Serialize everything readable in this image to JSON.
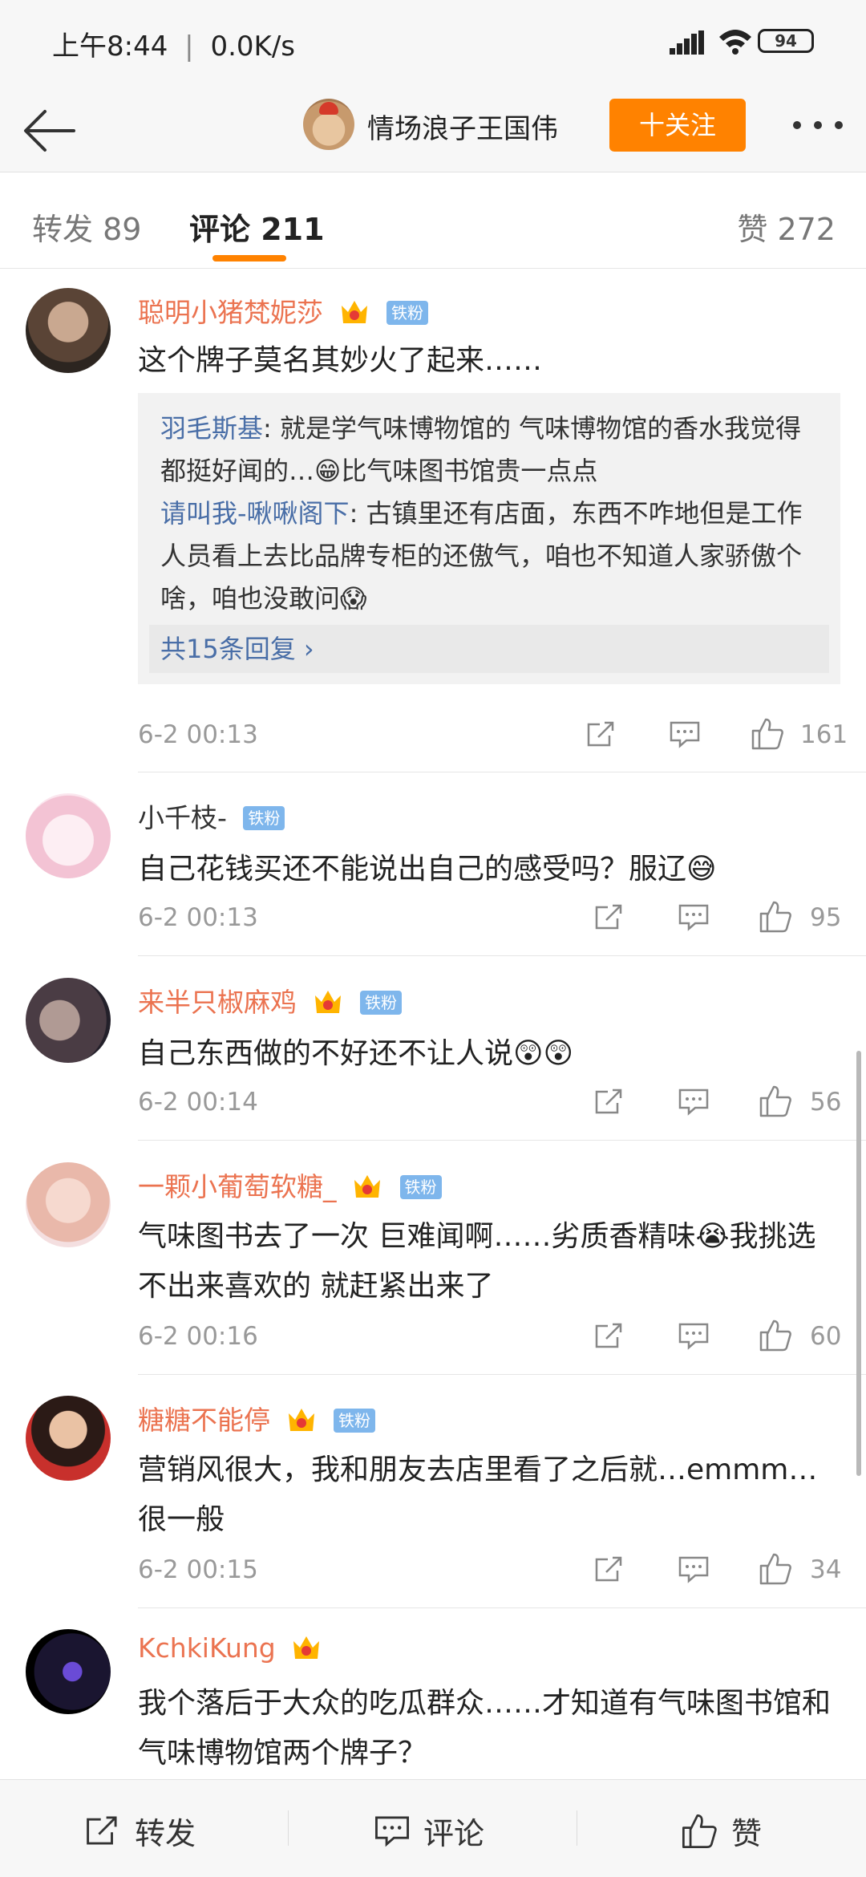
{
  "status_bar": {
    "time": "上午8:44",
    "separator": "|",
    "speed": "0.0K/s",
    "battery": "94"
  },
  "header": {
    "user_name": "情场浪子王国伟",
    "follow_label": "十关注"
  },
  "tabs": {
    "repost": "转发 89",
    "comment": "评论 211",
    "like": "赞 272"
  },
  "comments": [
    {
      "name": "聪明小猪梵妮莎",
      "badge": "铁粉",
      "text": "这个牌子莫名其妙火了起来……",
      "replies": [
        {
          "name": "羽毛斯基",
          "text": ": 就是学气味博物馆的 气味博物馆的香水我觉得都挺好闻的…😁比气味图书馆贵一点点"
        },
        {
          "name": "请叫我-啾啾阁下",
          "text": ": 古镇里还有店面，东西不咋地但是工作人员看上去比品牌专柜的还傲气，咱也不知道人家骄傲个啥，咱也没敢问😱"
        }
      ],
      "more_replies": "共15条回复 ›",
      "time": "6-2 00:13",
      "likes": "161"
    },
    {
      "name": "小千枝-",
      "badge": "铁粉",
      "text": "自己花钱买还不能说出自己的感受吗？服辽😅",
      "time": "6-2 00:13",
      "likes": "95"
    },
    {
      "name": "来半只椒麻鸡",
      "badge": "铁粉",
      "text": "自己东西做的不好还不让人说😲😲",
      "time": "6-2 00:14",
      "likes": "56"
    },
    {
      "name": "一颗小葡萄软糖_",
      "badge": "铁粉",
      "text": "气味图书去了一次 巨难闻啊……劣质香精味😭我挑选不出来喜欢的 就赶紧出来了",
      "time": "6-2 00:16",
      "likes": "60"
    },
    {
      "name": "糖糖不能停",
      "badge": "铁粉",
      "text": "营销风很大，我和朋友去店里看了之后就…emmm…很一般",
      "time": "6-2 00:15",
      "likes": "34"
    },
    {
      "name": "KchkiKung",
      "text": "我个落后于大众的吃瓜群众……才知道有气味图书馆和气味博物馆两个牌子？"
    }
  ],
  "bottom_bar": {
    "repost": "转发",
    "comment": "评论",
    "like": "赞"
  },
  "colors": {
    "accent": "#ff8200",
    "name_orange": "#eb7350",
    "reply_blue": "#496ea7",
    "badge_blue": "#7eb6ec"
  }
}
